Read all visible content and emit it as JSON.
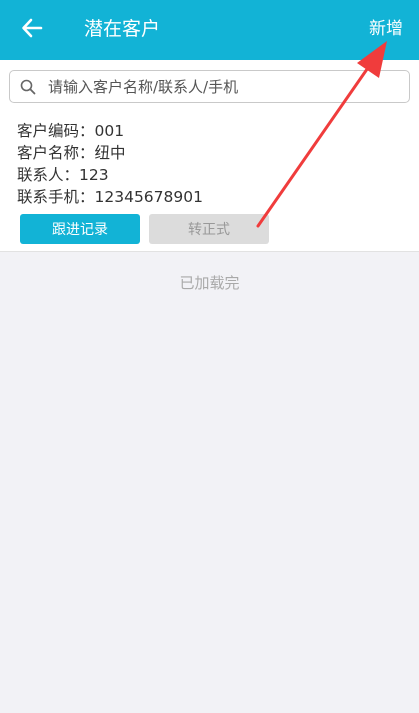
{
  "header": {
    "back_icon": "arrow-left-icon",
    "title": "潜在客户",
    "add_label": "新增"
  },
  "search": {
    "icon": "search-icon",
    "placeholder": "请输入客户名称/联系人/手机",
    "value": ""
  },
  "customers": [
    {
      "code_line": "客户编码：001",
      "name_line": "客户名称：纽中",
      "contact_line": "联系人：123",
      "phone_line": "联系手机：12345678901",
      "follow_label": "跟进记录",
      "convert_label": "转正式"
    }
  ],
  "list_status": "已加载完",
  "annotation": {
    "type": "red-arrow",
    "points_to": "新增",
    "color": "#f03c3c"
  },
  "colors": {
    "primary": "#12b3d6",
    "background": "#f2f2f6",
    "disabled_button": "#dcdcdc"
  }
}
